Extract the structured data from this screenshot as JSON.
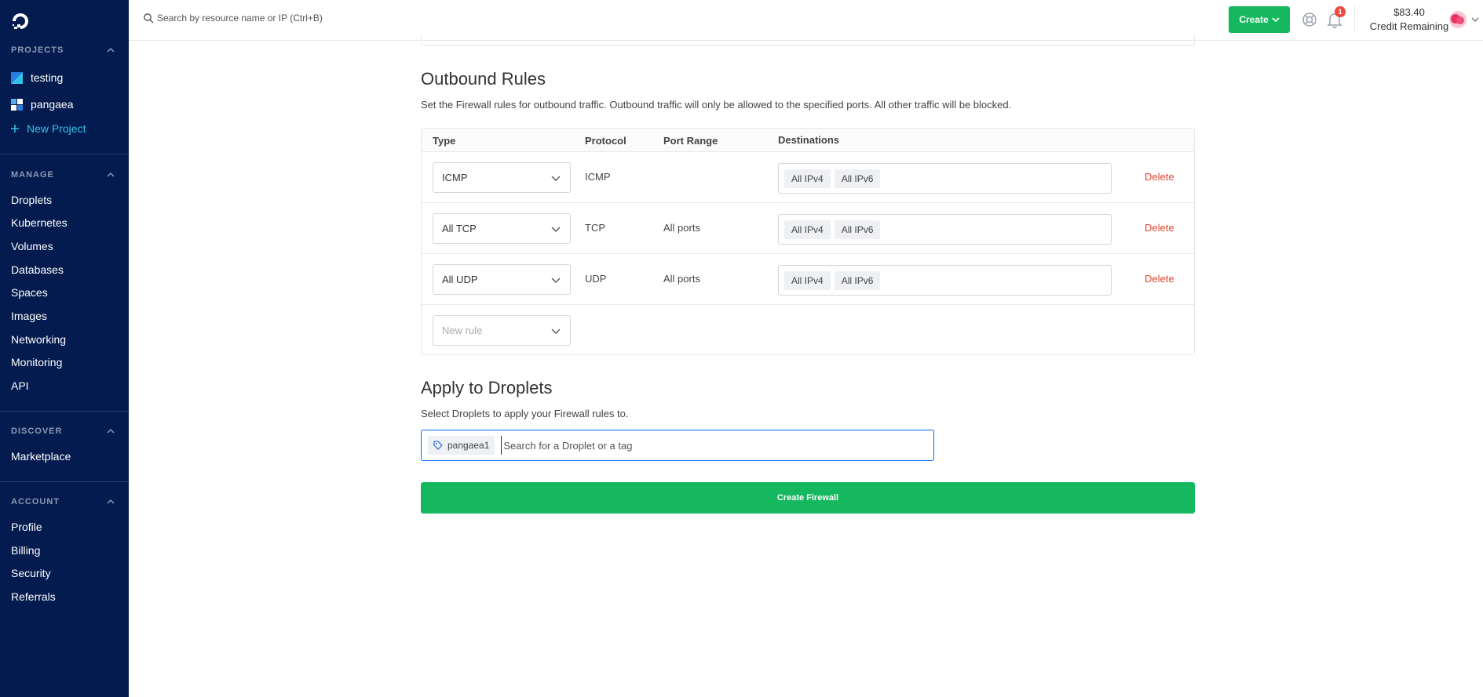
{
  "sidebar": {
    "projects_header": "PROJECTS",
    "projects": [
      {
        "label": "testing"
      },
      {
        "label": "pangaea"
      }
    ],
    "new_project": "New Project",
    "manage_header": "MANAGE",
    "manage_items": [
      "Droplets",
      "Kubernetes",
      "Volumes",
      "Databases",
      "Spaces",
      "Images",
      "Networking",
      "Monitoring",
      "API"
    ],
    "discover_header": "DISCOVER",
    "discover_items": [
      "Marketplace"
    ],
    "account_header": "ACCOUNT",
    "account_items": [
      "Profile",
      "Billing",
      "Security",
      "Referrals"
    ]
  },
  "topbar": {
    "search_placeholder": "Search by resource name or IP (Ctrl+B)",
    "create_label": "Create",
    "notification_count": "1",
    "credit_amount": "$83.40",
    "credit_label": "Credit Remaining"
  },
  "outbound": {
    "title": "Outbound Rules",
    "description": "Set the Firewall rules for outbound traffic. Outbound traffic will only be allowed to the specified ports. All other traffic will be blocked.",
    "columns": {
      "type": "Type",
      "protocol": "Protocol",
      "port_range": "Port Range",
      "destinations": "Destinations"
    },
    "rules": [
      {
        "type": "ICMP",
        "protocol": "ICMP",
        "port_range": "",
        "destinations": [
          "All IPv4",
          "All IPv6"
        ],
        "delete": "Delete"
      },
      {
        "type": "All TCP",
        "protocol": "TCP",
        "port_range": "All ports",
        "destinations": [
          "All IPv4",
          "All IPv6"
        ],
        "delete": "Delete"
      },
      {
        "type": "All UDP",
        "protocol": "UDP",
        "port_range": "All ports",
        "destinations": [
          "All IPv4",
          "All IPv6"
        ],
        "delete": "Delete"
      }
    ],
    "new_rule_placeholder": "New rule"
  },
  "apply": {
    "title": "Apply to Droplets",
    "description": "Select Droplets to apply your Firewall rules to.",
    "tag": "pangaea1",
    "search_placeholder": "Search for a Droplet or a tag"
  },
  "create_firewall_label": "Create Firewall",
  "colors": {
    "sidebar_bg": "#031b4e",
    "accent_green": "#15b85e",
    "delete_red": "#e4452c",
    "link_cyan": "#36c1e8",
    "focus_blue": "#0069ff"
  }
}
